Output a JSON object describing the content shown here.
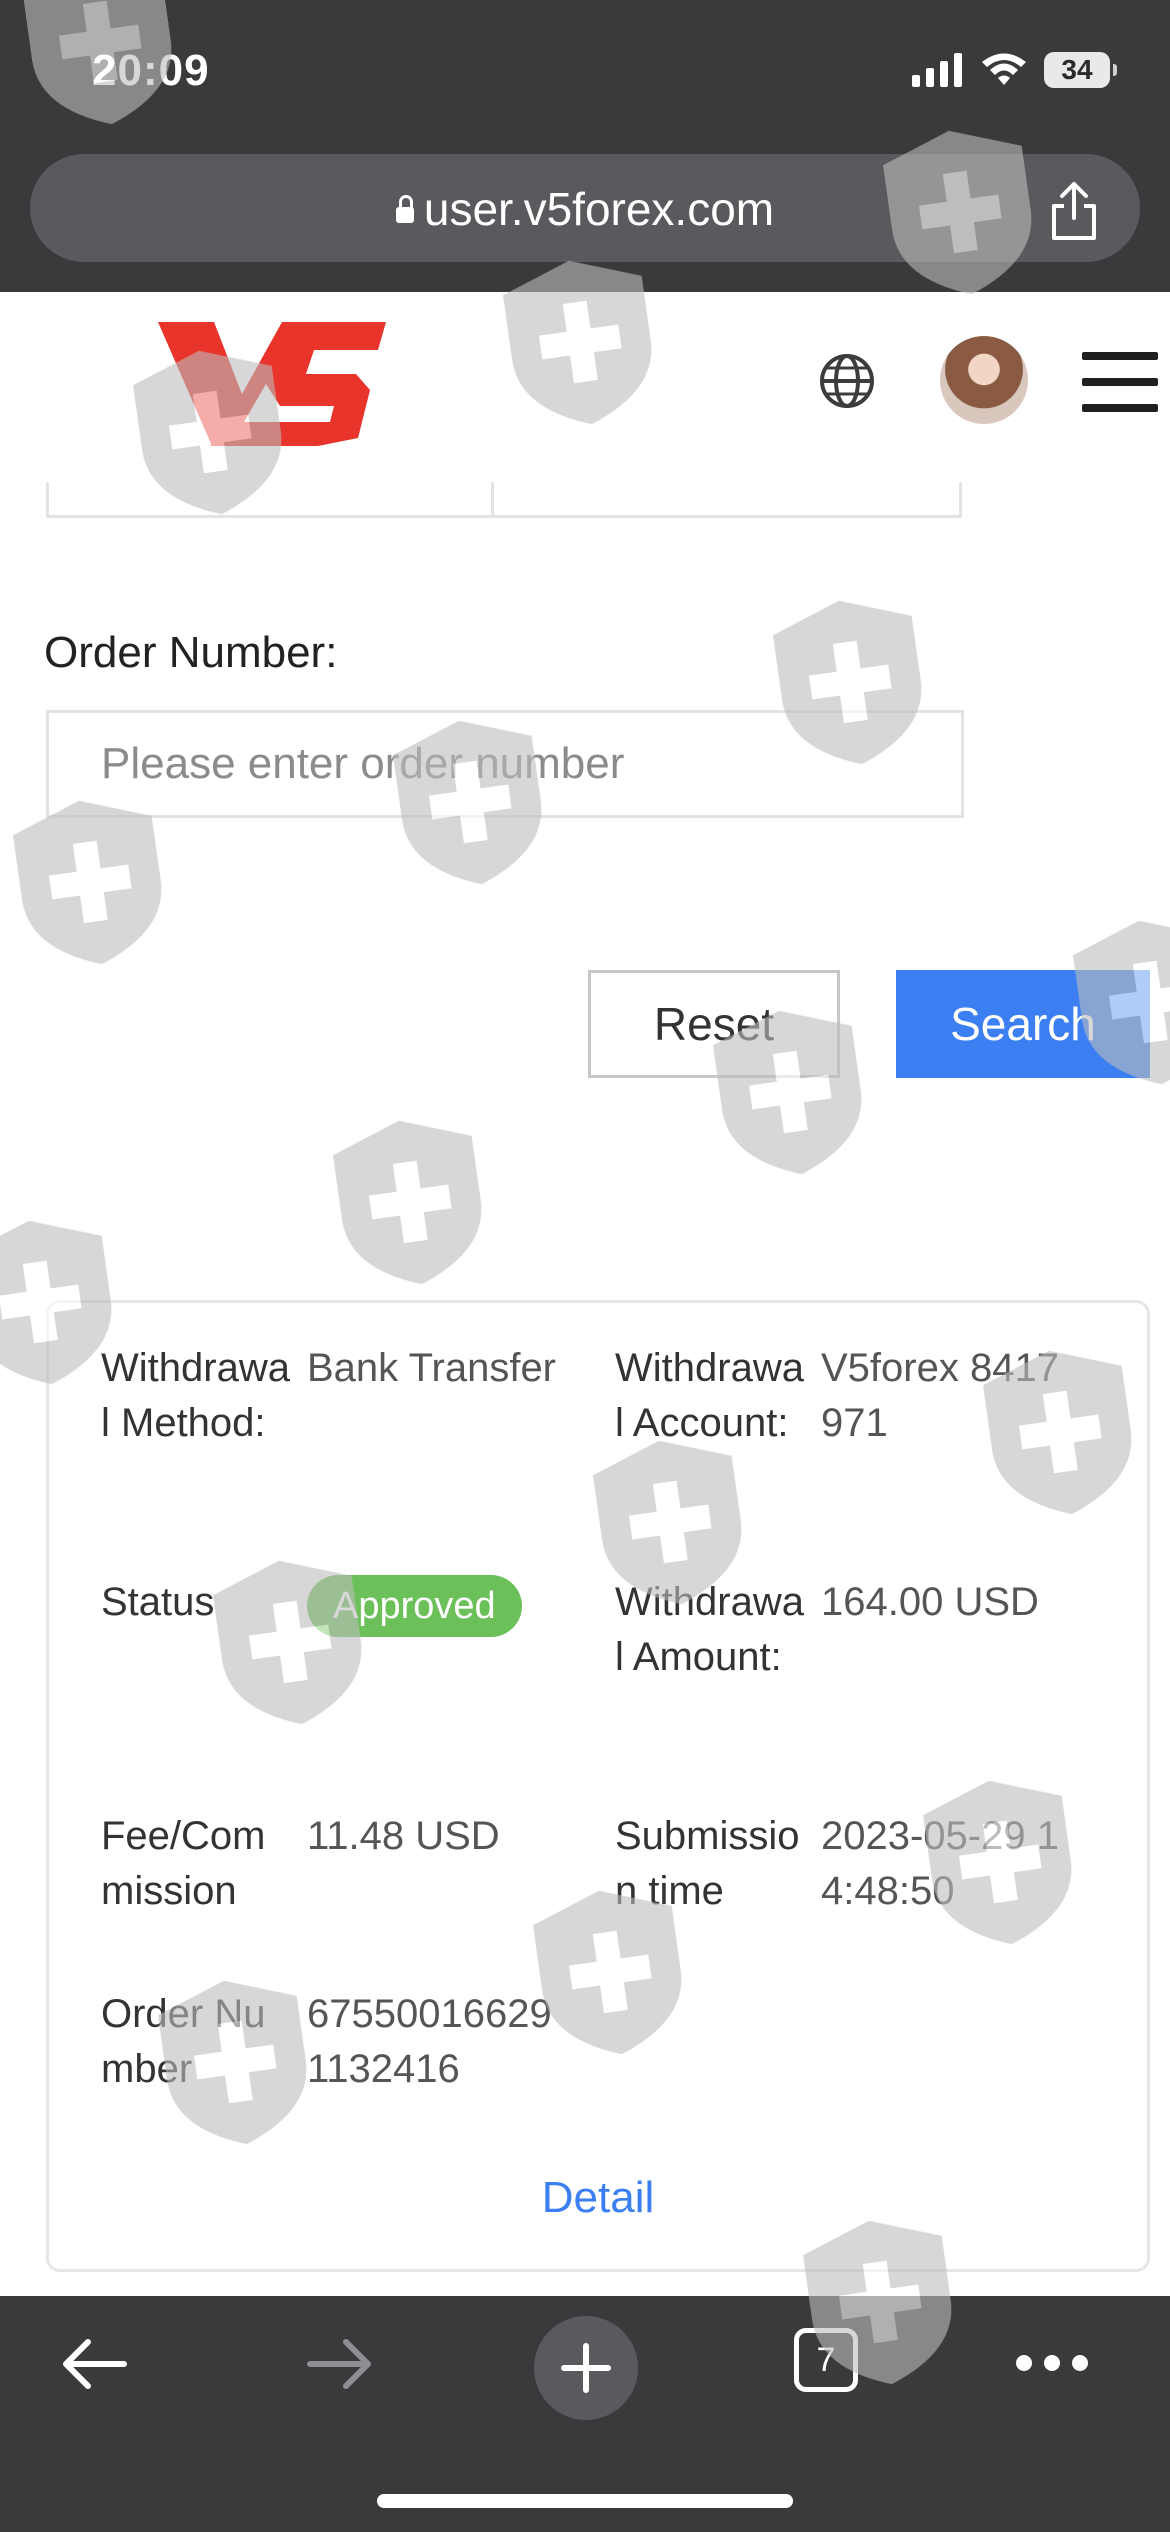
{
  "status_bar": {
    "time": "20:09",
    "battery": "34"
  },
  "browser": {
    "url": "user.v5forex.com",
    "open_tabs": "7"
  },
  "site": {
    "brand": "V5"
  },
  "filters": {
    "order_number_label": "Order Number:",
    "order_number_placeholder": "Please enter order number",
    "reset_label": "Reset",
    "search_label": "Search"
  },
  "record": {
    "withdrawal_method_label": "Withdrawal Method:",
    "withdrawal_method_value": "Bank Transfer",
    "withdrawal_account_label": "Withdrawal Account:",
    "withdrawal_account_value": "V5forex 8417971",
    "status_label": "Status",
    "status_value": "Approved",
    "withdrawal_amount_label": "Withdrawal Amount:",
    "withdrawal_amount_value": "164.00 USD",
    "fee_label": "Fee/Commission",
    "fee_value": "11.48 USD",
    "submission_time_label": "Submission time",
    "submission_time_value": "2023-05-29 14:48:50",
    "order_number_label": "Order Number",
    "order_number_value": "675500166291132416",
    "detail_label": "Detail"
  },
  "colors": {
    "accent": "#3b7ff2",
    "approved": "#6cc05a",
    "brand_red": "#e8342a",
    "toolbar": "#3a3a3c"
  },
  "icons": [
    "lock-icon",
    "share-icon",
    "globe-icon",
    "hamburger-icon",
    "back-icon",
    "forward-icon",
    "new-tab-icon",
    "tabs-icon",
    "more-icon",
    "shield-watermark-icon"
  ]
}
